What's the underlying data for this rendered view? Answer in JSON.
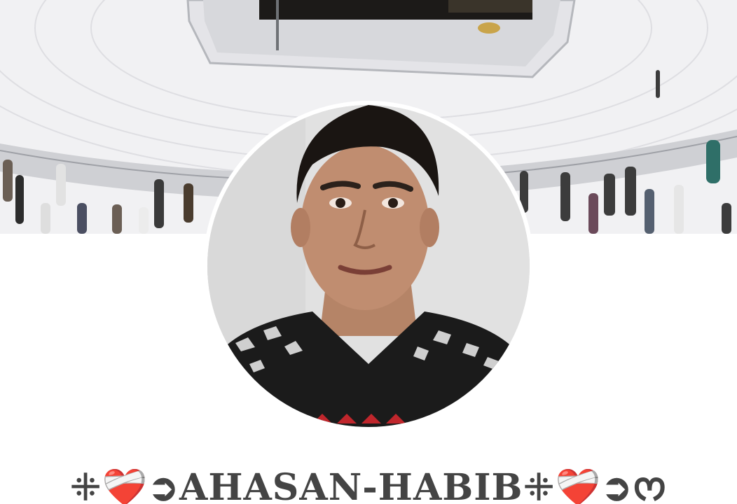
{
  "profile": {
    "name": "ꔰ❤️‍🩹➲AHASAN-HABIBꔰ❤️‍🩹➲ᰔ",
    "cover_photo": "kaaba-cover-photo",
    "profile_photo": "profile-photo"
  },
  "colors": {
    "background": "#ffffff",
    "name_text": "#444444"
  }
}
